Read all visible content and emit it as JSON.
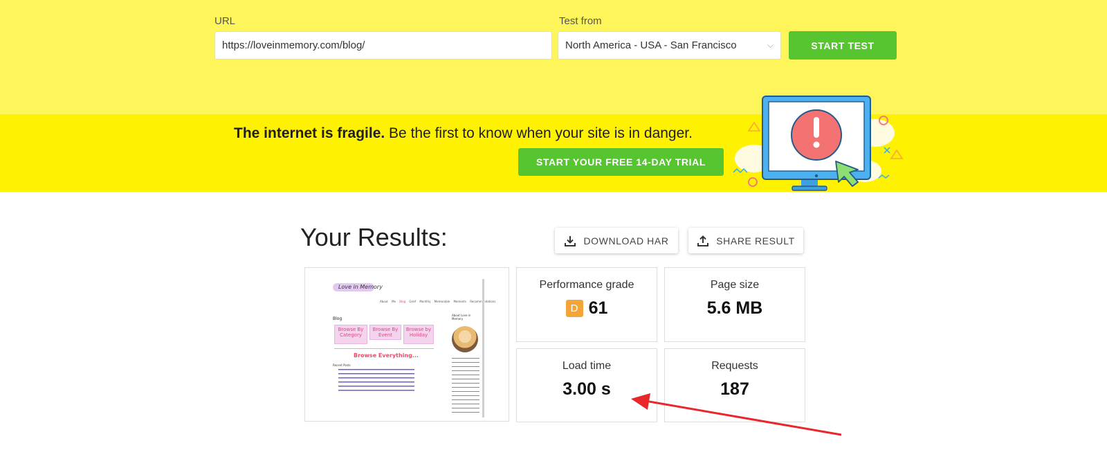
{
  "form": {
    "url_label": "URL",
    "url_value": "https://loveinmemory.com/blog/",
    "test_from_label": "Test from",
    "test_from_value": "North America - USA - San Francisco",
    "start_test_label": "START TEST"
  },
  "banner": {
    "headline_bold": "The internet is fragile.",
    "headline_rest": " Be the first to know when your site is in danger.",
    "trial_button": "START YOUR FREE 14-DAY TRIAL"
  },
  "results": {
    "title": "Your Results:",
    "download_har": "DOWNLOAD HAR",
    "share_result": "SHARE RESULT",
    "performance_label": "Performance grade",
    "performance_grade": "D",
    "performance_score": "61",
    "page_size_label": "Page size",
    "page_size_value": "5.6 MB",
    "load_time_label": "Load time",
    "load_time_value": "3.00 s",
    "requests_label": "Requests",
    "requests_value": "187"
  },
  "screenshot": {
    "logo": "Love in Memory",
    "nav": [
      "About Me",
      "Blog",
      "Grief Monthly",
      "Memorable Moments",
      "Recommendations"
    ],
    "heading": "Blog",
    "tiles": [
      "Browse By Category",
      "Browse By Event",
      "Browse by Holiday"
    ],
    "browse": "Browse Everything...",
    "recent": "Recent Posts",
    "sidebar_title": "About Love in Memory"
  },
  "colors": {
    "top_bg": "#fdf55a",
    "banner_bg": "#fff200",
    "green": "#57c52f",
    "grade": "#f3a53a",
    "arrow": "#e8262b"
  }
}
